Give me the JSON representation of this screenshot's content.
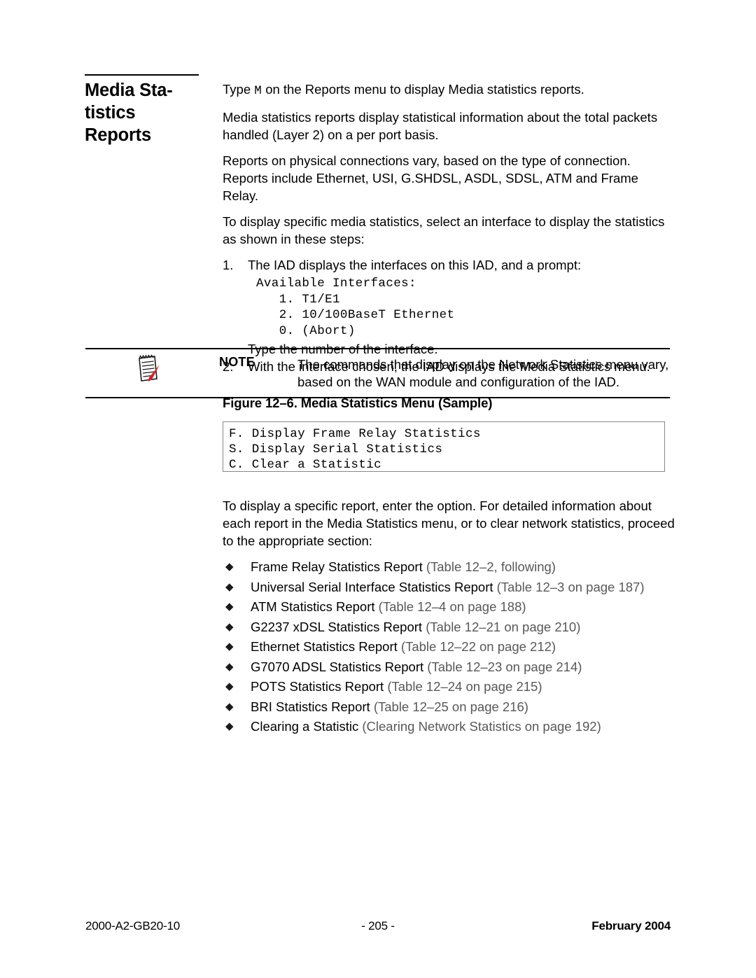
{
  "heading": {
    "title": "Media Sta-\ntistics\nReports"
  },
  "body": {
    "p1_pre": "Type ",
    "p1_mono": "M",
    "p1_post": " on the Reports menu to display Media statistics reports.",
    "p2": "Media statistics reports display statistical information about the total packets handled (Layer 2) on a per port basis.",
    "p3": "Reports on physical connections vary, based on the type of connection. Reports include Ethernet, USI, G.SHDSL, ASDL, SDSL, ATM and Frame Relay.",
    "p4": "To display specific media statistics, select an interface to display the statistics as shown in these steps:",
    "steps": [
      {
        "num": "1.",
        "text": "The IAD displays the interfaces on this IAD, and a prompt:",
        "code": "Available Interfaces:\n   1. T1/E1\n   2. 10/100BaseT Ethernet\n   0. (Abort)",
        "follow": "Type the number of the interface."
      },
      {
        "num": "2.",
        "text": "With the interface chosen, the IAD displays the Media Statistics menu.",
        "code": "",
        "follow": ""
      }
    ]
  },
  "note": {
    "icon_name": "notepad-pencil-icon",
    "label": "NOTE",
    "text": "The commands that display on the Network Statistics menu vary, based on the WAN module and configuration of the IAD."
  },
  "figure": {
    "caption": "Figure 12–6.  Media Statistics Menu (Sample)",
    "content": "F. Display Frame Relay Statistics\nS. Display Serial Statistics\nC. Clear a Statistic"
  },
  "after_figure": {
    "paragraph": "To display a specific report, enter the option. For detailed information about each report in the Media Statistics menu, or to clear network statistics, proceed to the appropriate section:",
    "bullet_glyph": "◆",
    "bullets": [
      {
        "text": "Frame Relay Statistics Report ",
        "xref": "(Table 12–2, following)"
      },
      {
        "text": "Universal Serial Interface Statistics Report ",
        "xref": "(Table 12–3 on page 187)"
      },
      {
        "text": "ATM Statistics Report ",
        "xref": "(Table 12–4 on page 188)"
      },
      {
        "text": "G2237 xDSL Statistics Report ",
        "xref": "(Table 12–21 on page 210)"
      },
      {
        "text": "Ethernet Statistics Report ",
        "xref": "(Table 12–22 on page 212)"
      },
      {
        "text": "G7070 ADSL Statistics Report ",
        "xref": "(Table 12–23 on page 214)"
      },
      {
        "text": "POTS Statistics Report ",
        "xref": "(Table 12–24 on page 215)"
      },
      {
        "text": "BRI Statistics Report ",
        "xref": "(Table 12–25 on page 216)"
      },
      {
        "text": "Clearing a Statistic ",
        "xref": "(Clearing Network Statistics on page 192)"
      }
    ]
  },
  "footer": {
    "doc_number": "2000-A2-GB20-10",
    "page_number": "- 205 -",
    "date": "February 2004"
  },
  "colors": {
    "text": "#000000",
    "xref": "#585858",
    "rule": "#000000",
    "figure_border": "#888888",
    "pencil_red": "#d8202a"
  }
}
